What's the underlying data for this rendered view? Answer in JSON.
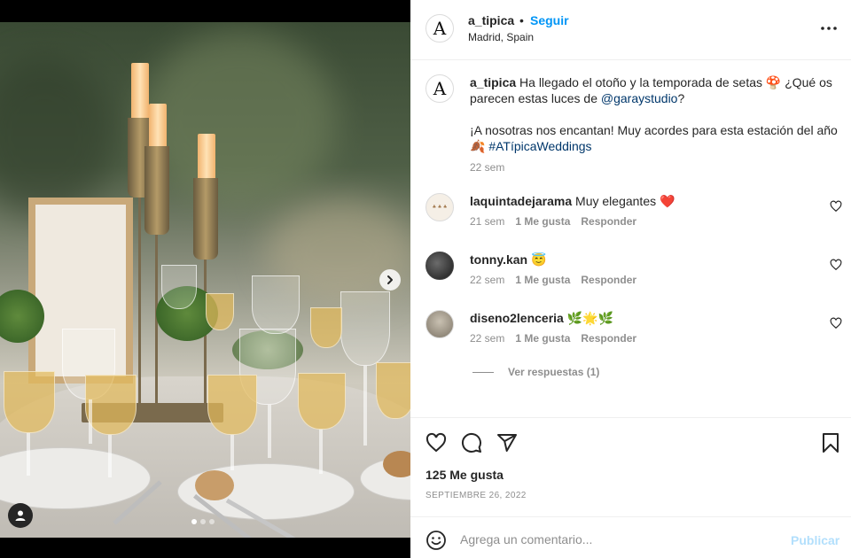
{
  "post": {
    "author": "a_tipica",
    "author_avatar_letter": "A",
    "separator": "•",
    "follow_label": "Seguir",
    "location": "Madrid, Spain"
  },
  "caption": {
    "author": "a_tipica",
    "text_1": "Ha llegado el otoño y la temporada de setas 🍄 ¿Qué os parecen estas luces de ",
    "mention": "@garaystudio",
    "text_2": "?",
    "text_3": "¡A nosotras nos encantan! Muy acordes para esta estación del año 🍂 ",
    "hashtag": "#ATípicaWeddings",
    "time": "22 sem"
  },
  "comments": [
    {
      "user": "laquintadejarama",
      "text": "Muy elegantes ❤️",
      "time": "21 sem",
      "likes": "1 Me gusta",
      "reply": "Responder",
      "avatar_text": "♣ ♣ ♣"
    },
    {
      "user": "tonny.kan",
      "text": "😇",
      "time": "22 sem",
      "likes": "1 Me gusta",
      "reply": "Responder"
    },
    {
      "user": "diseno2lenceria",
      "text": "🌿🌟🌿",
      "time": "22 sem",
      "likes": "1 Me gusta",
      "reply": "Responder"
    }
  ],
  "view_replies": "Ver respuestas (1)",
  "likes": "125 Me gusta",
  "date": "SEPTIEMBRE 26, 2022",
  "composer": {
    "placeholder": "Agrega un comentario...",
    "post_label": "Publicar"
  },
  "carousel": {
    "count": 3,
    "active": 0
  },
  "icons": {
    "more": "more-horizontal-icon",
    "heart": "heart-icon",
    "comment": "comment-icon",
    "share": "share-icon",
    "save": "bookmark-icon",
    "emoji": "emoji-icon",
    "next": "chevron-right-icon",
    "tag": "user-tag-icon"
  },
  "colors": {
    "link_blue": "#0095f6",
    "mention": "#00376b",
    "muted": "#8e8e8e",
    "heart_red": "#ed4956"
  }
}
